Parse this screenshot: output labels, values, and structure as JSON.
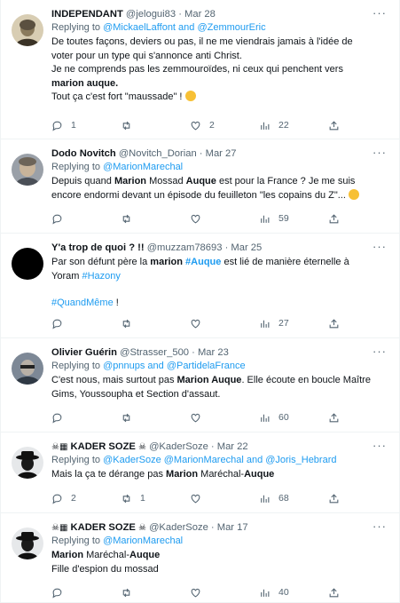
{
  "tweets": [
    {
      "name": "INDEPENDANT",
      "handle": "@jelogui83",
      "date": "Mar 28",
      "reply_prefix": "Replying to ",
      "reply_link": "@MickaelLaffont and @ZemmourEric",
      "lines": [
        "De toutes façons, deviers ou pas, il ne me viendrais jamais à l'idée de",
        "voter pour un type qui s'annonce anti Christ.",
        "Je ne comprends pas les zemmouroïdes, ni ceux qui penchent vers",
        "marion auque.",
        "Tout ça c'est fort \"maussade\" !"
      ],
      "replies": "1",
      "retweets": "",
      "likes": "2",
      "views": "22"
    },
    {
      "name": "Dodo Novitch",
      "handle": "@Novitch_Dorian",
      "date": "Mar 27",
      "reply_prefix": "Replying to ",
      "reply_link": "@MarionMarechal",
      "line1_a": "Depuis quand ",
      "line1_b": "Marion",
      "line1_c": " Mossad ",
      "line1_d": "Auque",
      "line1_e": " est pour la France ? Je me suis",
      "line2": "encore endormi devant un épisode du feuilleton \"les copains du Z\"...",
      "replies": "",
      "retweets": "",
      "likes": "",
      "views": "59"
    },
    {
      "name": "Y'a trop de quoi ? !!",
      "handle": "@muzzam78693",
      "date": "Mar 25",
      "line1_a": "Par son défunt père la ",
      "line1_b": "marion",
      "line1_c": " ",
      "line1_d": "#Auque",
      "line1_e": " est lié de manière éternelle à",
      "line2_a": "Yoram ",
      "line2_b": "#Hazony",
      "line3_a": "#QuandMême",
      "line3_b": " !",
      "replies": "",
      "retweets": "",
      "likes": "",
      "views": "27"
    },
    {
      "name": "Olivier Guérin",
      "handle": "@Strasser_500",
      "date": "Mar 23",
      "reply_prefix": "Replying to ",
      "reply_link": "@pnnups and @PartidelaFrance",
      "line1_a": "C'est nous, mais surtout pas ",
      "line1_b": "Marion Auque",
      "line1_c": ". Elle écoute en boucle Maître",
      "line2": "Gims, Youssoupha et Section d'assaut.",
      "replies": "",
      "retweets": "",
      "likes": "",
      "views": "60"
    },
    {
      "name": "KADER SOZE",
      "handle": "@KaderSoze",
      "date": "Mar 22",
      "reply_prefix": "Replying to ",
      "reply_link": "@KaderSoze @MarionMarechal and @Joris_Hebrard",
      "line1_a": "Mais la ça te dérange pas ",
      "line1_b": "Marion",
      "line1_c": " Maréchal-",
      "line1_d": "Auque",
      "replies": "2",
      "retweets": "1",
      "likes": "",
      "views": "68"
    },
    {
      "name": "KADER SOZE",
      "handle": "@KaderSoze",
      "date": "Mar 17",
      "reply_prefix": "Replying to ",
      "reply_link": "@MarionMarechal",
      "line1_a": "Marion",
      "line1_b": " Maréchal-",
      "line1_c": "Auque",
      "line2": "Fille d'espion du mossad",
      "replies": "",
      "retweets": "",
      "likes": "",
      "views": "40"
    }
  ],
  "ui": {
    "sep": "·",
    "more": "···"
  },
  "colors": {
    "link": "#1d9bf0",
    "muted": "#536471",
    "text": "#0f1419",
    "border": "#eff3f4"
  },
  "icons": {
    "reply": "reply-icon",
    "retweet": "retweet-icon",
    "like": "heart-icon",
    "views": "views-icon",
    "share": "share-icon",
    "more": "more-icon"
  }
}
